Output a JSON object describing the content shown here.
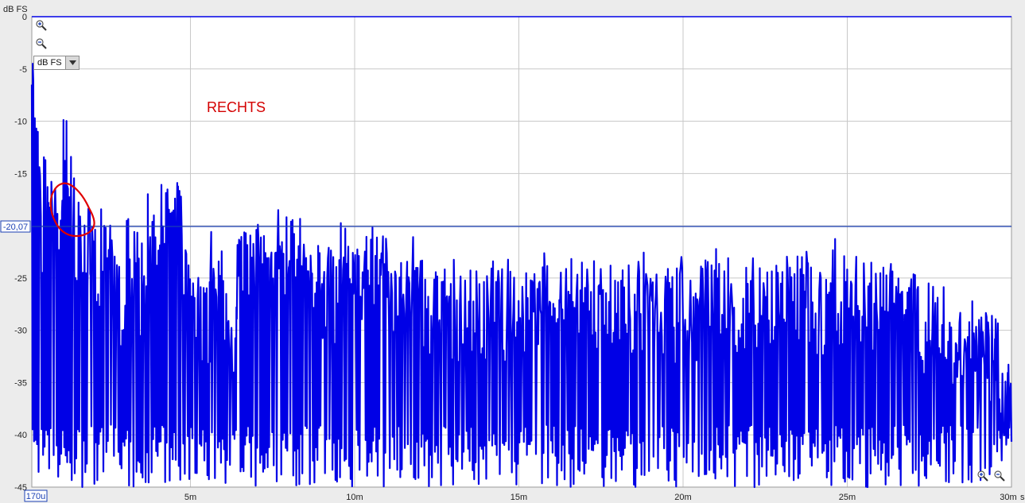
{
  "chart_data": {
    "type": "line",
    "annotation_text": "RECHTS",
    "y_unit_label": "dB FS",
    "x_unit_label": "s",
    "ylim": [
      -45,
      0
    ],
    "xlim": [
      0.00017,
      0.03
    ],
    "grid": true,
    "y_ticks": [
      {
        "value": 0,
        "label": "0"
      },
      {
        "value": -5,
        "label": "-5"
      },
      {
        "value": -10,
        "label": "-10"
      },
      {
        "value": -15,
        "label": "-15"
      },
      {
        "value": -20,
        "label": ""
      },
      {
        "value": -25,
        "label": "-25"
      },
      {
        "value": -30,
        "label": "-30"
      },
      {
        "value": -35,
        "label": "-35"
      },
      {
        "value": -40,
        "label": "-40"
      },
      {
        "value": -45,
        "label": "-45"
      }
    ],
    "x_ticks": [
      {
        "value": 0.00017,
        "label": "170u"
      },
      {
        "value": 0.005,
        "label": "5m"
      },
      {
        "value": 0.01,
        "label": "10m"
      },
      {
        "value": 0.015,
        "label": "15m"
      },
      {
        "value": 0.02,
        "label": "20m"
      },
      {
        "value": 0.025,
        "label": "25m"
      },
      {
        "value": 0.03,
        "label": "30m"
      }
    ],
    "cursor": {
      "value": -20.07,
      "label": "-20,07"
    },
    "colors": {
      "series": "#0000e6",
      "cursor": "#1a3fb4",
      "annotation": "#d40000",
      "grid": "#c8c8c8"
    },
    "series": [
      {
        "peaks": [
          [
            0.0002,
            -4.5
          ],
          [
            0.00025,
            -10.2
          ],
          [
            0.00035,
            -17
          ],
          [
            0.0005,
            -24.5
          ],
          [
            0.00065,
            -16.3
          ],
          [
            0.00085,
            -24.5
          ],
          [
            0.00105,
            -19.5
          ],
          [
            0.0011,
            -17.6
          ],
          [
            0.00125,
            -16.2
          ],
          [
            0.0015,
            -25
          ],
          [
            0.00195,
            -24.6
          ],
          [
            0.0025,
            -27.5
          ],
          [
            0.003,
            -30.5
          ],
          [
            0.0037,
            -26.3
          ],
          [
            0.0041,
            -24.9
          ],
          [
            0.0044,
            -22.4
          ],
          [
            0.0046,
            -22
          ],
          [
            0.005,
            -30.5
          ],
          [
            0.0056,
            -33
          ],
          [
            0.0064,
            -27.8
          ],
          [
            0.007,
            -27
          ],
          [
            0.0076,
            -26.5
          ],
          [
            0.008,
            -24.3
          ],
          [
            0.0085,
            -28.5
          ],
          [
            0.0095,
            -29.5
          ],
          [
            0.0102,
            -27.5
          ],
          [
            0.0113,
            -28.8
          ],
          [
            0.0118,
            -28.5
          ],
          [
            0.0126,
            -31.5
          ],
          [
            0.0132,
            -30
          ],
          [
            0.0142,
            -31.5
          ],
          [
            0.015,
            -30.5
          ],
          [
            0.0163,
            -30.2
          ],
          [
            0.0176,
            -30.5
          ],
          [
            0.0186,
            -30.2
          ],
          [
            0.0198,
            -32
          ],
          [
            0.0205,
            -30.5
          ],
          [
            0.022,
            -29.5
          ],
          [
            0.023,
            -32
          ],
          [
            0.0245,
            -28.5
          ],
          [
            0.0248,
            -29.8
          ],
          [
            0.0262,
            -30.5
          ],
          [
            0.0275,
            -32.5
          ],
          [
            0.0288,
            -35.1
          ],
          [
            0.0295,
            -34.8
          ],
          [
            0.0299,
            -40.3
          ]
        ]
      }
    ]
  },
  "tools": {
    "zoom_in_icon": "zoom-in-icon",
    "zoom_out_icon": "zoom-out-icon"
  },
  "unit_select": {
    "value": "dB FS"
  }
}
